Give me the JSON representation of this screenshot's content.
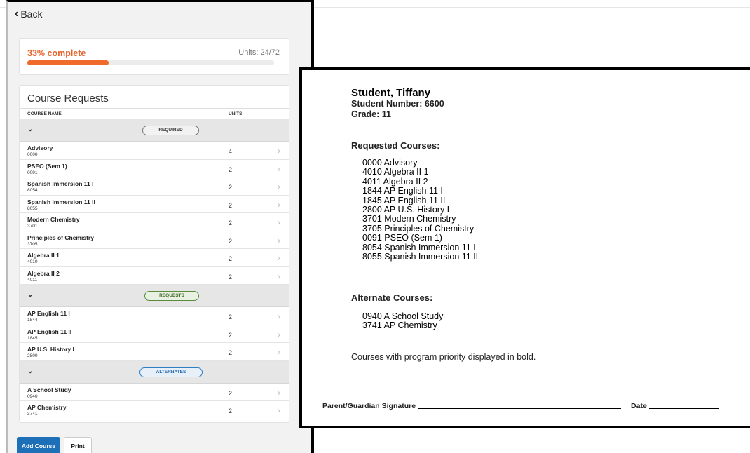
{
  "nav": {
    "back_label": "Back"
  },
  "progress": {
    "label": "33% complete",
    "units": "Units: 24/72",
    "percent": 33
  },
  "course_requests": {
    "title": "Course Requests",
    "columns": {
      "name": "COURSE NAME",
      "units": "UNITS"
    },
    "groups": [
      {
        "label": "REQUIRED",
        "courses": [
          {
            "name": "Advisory",
            "code": "0000",
            "units": "4"
          },
          {
            "name": "PSEO (Sem 1)",
            "code": "0091",
            "units": "2"
          },
          {
            "name": "Spanish Immersion 11 I",
            "code": "8054",
            "units": "2"
          },
          {
            "name": "Spanish Immersion 11 II",
            "code": "8055",
            "units": "2"
          },
          {
            "name": "Modern Chemistry",
            "code": "3701",
            "units": "2"
          },
          {
            "name": "Principles of Chemistry",
            "code": "3705",
            "units": "2"
          },
          {
            "name": "Algebra II 1",
            "code": "4010",
            "units": "2"
          },
          {
            "name": "Algebra II 2",
            "code": "4011",
            "units": "2"
          }
        ]
      },
      {
        "label": "REQUESTS",
        "courses": [
          {
            "name": "AP English 11 I",
            "code": "1844",
            "units": "2"
          },
          {
            "name": "AP English 11 II",
            "code": "1845",
            "units": "2"
          },
          {
            "name": "AP U.S. History I",
            "code": "2800",
            "units": "2"
          }
        ]
      },
      {
        "label": "ALTERNATES",
        "courses": [
          {
            "name": "A School Study",
            "code": "0940",
            "units": "2"
          },
          {
            "name": "AP Chemistry",
            "code": "3741",
            "units": "2"
          }
        ]
      }
    ]
  },
  "buttons": {
    "add_course": "Add Course",
    "print": "Print"
  },
  "document": {
    "student_name": "Student, Tiffany",
    "student_number": "Student Number: 6600",
    "grade": "Grade: 11",
    "requested_heading": "Requested Courses:",
    "requested": [
      "0000 Advisory",
      "4010 Algebra II 1",
      "4011 Algebra II 2",
      "1844 AP English 11 I",
      "1845 AP English 11 II",
      "2800 AP U.S. History I",
      "3701 Modern Chemistry",
      "3705 Principles of Chemistry",
      "0091 PSEO (Sem 1)",
      "8054 Spanish Immersion 11 I",
      "8055 Spanish Immersion 11 II"
    ],
    "alternate_heading": "Alternate Courses:",
    "alternates": [
      "0940 A School Study",
      "3741 AP Chemistry"
    ],
    "note": "Courses with program priority displayed in bold.",
    "signature_label": "Parent/Guardian Signature",
    "date_label": "Date"
  }
}
